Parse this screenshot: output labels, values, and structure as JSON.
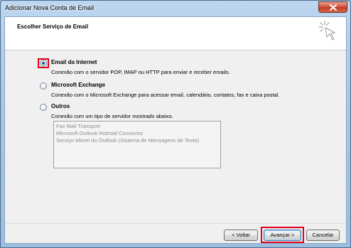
{
  "window": {
    "title": "Adicionar Nova Conta de Email"
  },
  "header": {
    "title": "Escolher Serviço de Email"
  },
  "options": [
    {
      "label": "Email da Internet",
      "description": "Conexão com o servidor POP, IMAP ou HTTP para enviar e receber emails.",
      "selected": true
    },
    {
      "label": "Microsoft Exchange",
      "description": "Conexão com o Microsoft Exchange para acessar email, calendário, contatos, fax e caixa postal.",
      "selected": false
    },
    {
      "label": "Outros",
      "description": "Conexão com um tipo de servidor mostrado abaixo.",
      "selected": false
    }
  ],
  "other_servers": [
    "Fax Mail Transport",
    "Microsoft Outlook Hotmail Connector",
    "Serviço Móvel do Outlook (Sistema de Mensagens de Texto)"
  ],
  "buttons": {
    "back": "< Voltar",
    "next": "Avançar >",
    "cancel": "Cancelar"
  },
  "colors": {
    "highlight": "#e0001a",
    "radio_dot": "#1d4f91"
  }
}
